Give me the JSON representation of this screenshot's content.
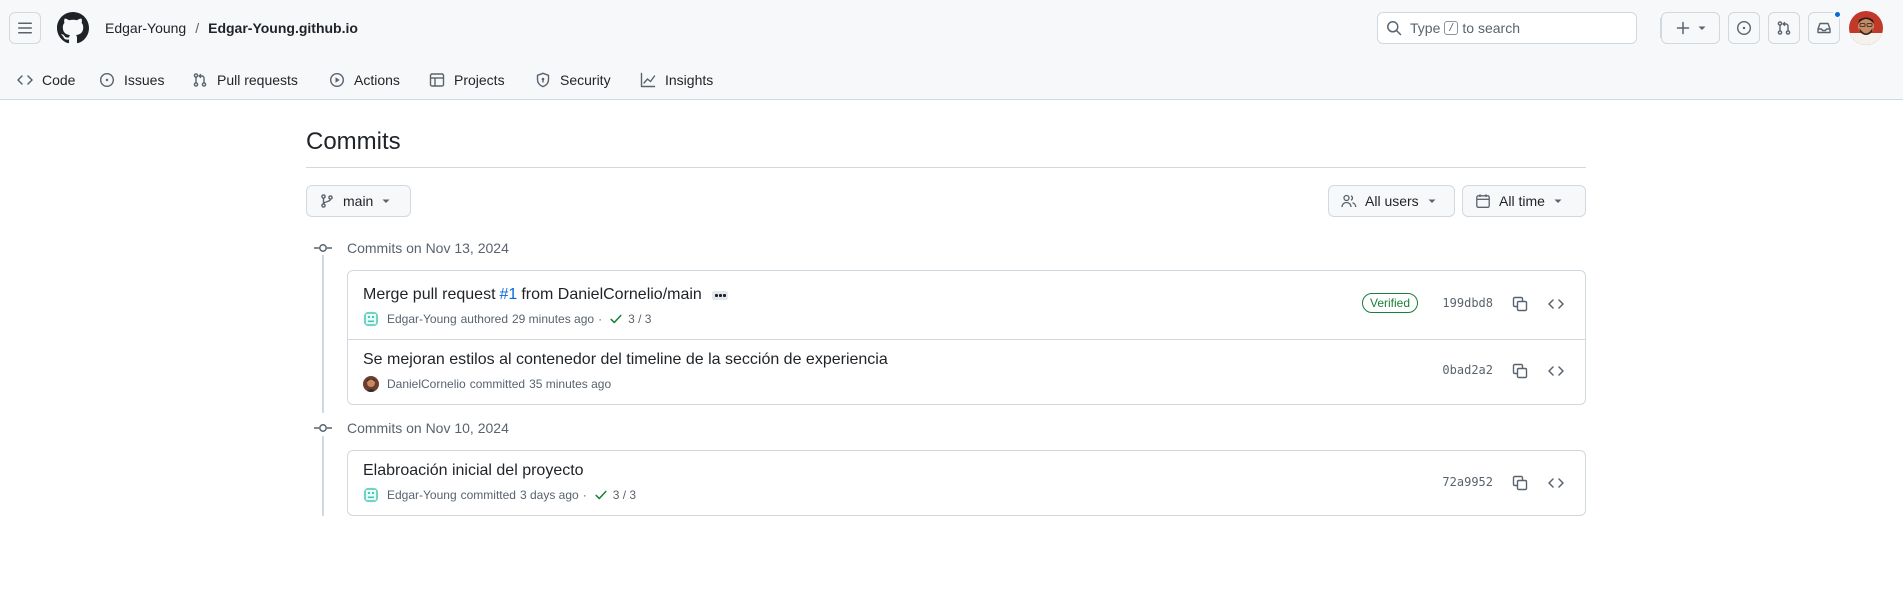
{
  "header": {
    "owner": "Edgar-Young",
    "separator": "/",
    "repo": "Edgar-Young.github.io",
    "search_prefix": "Type",
    "search_key": "/",
    "search_suffix": "to search"
  },
  "tabs": [
    {
      "label": "Code",
      "icon": "code-icon"
    },
    {
      "label": "Issues",
      "icon": "issue-opened-icon"
    },
    {
      "label": "Pull requests",
      "icon": "git-pull-request-icon"
    },
    {
      "label": "Actions",
      "icon": "play-icon"
    },
    {
      "label": "Projects",
      "icon": "table-icon"
    },
    {
      "label": "Security",
      "icon": "shield-icon"
    },
    {
      "label": "Insights",
      "icon": "graph-icon"
    }
  ],
  "main": {
    "title": "Commits",
    "branch": "main",
    "users_filter": "All users",
    "time_filter": "All time"
  },
  "groups": [
    {
      "date_label": "Commits on Nov 13, 2024",
      "commits": [
        {
          "message_prefix": "Merge pull request",
          "pr_ref": "#1",
          "message_suffix": "from DanielCornelio/main",
          "author": "Edgar-Young",
          "action": "authored",
          "time": "29 minutes ago",
          "checks": "3 / 3",
          "badge": "Verified",
          "sha": "199dbd8"
        },
        {
          "message": "Se mejoran estilos al contenedor del timeline de la sección de experiencia",
          "author": "DanielCornelio",
          "action": "committed",
          "time": "35 minutes ago",
          "sha": "0bad2a2"
        }
      ]
    },
    {
      "date_label": "Commits on Nov 10, 2024",
      "commits": [
        {
          "message": "Elabroación inicial del proyecto",
          "author": "Edgar-Young",
          "action": "committed",
          "time": "3 days ago",
          "checks": "3 / 3",
          "sha": "72a9952"
        }
      ]
    }
  ],
  "colors": {
    "accent": "#0969da",
    "success": "#1a7f37",
    "muted": "#59636e",
    "border": "#d1d9e0"
  }
}
